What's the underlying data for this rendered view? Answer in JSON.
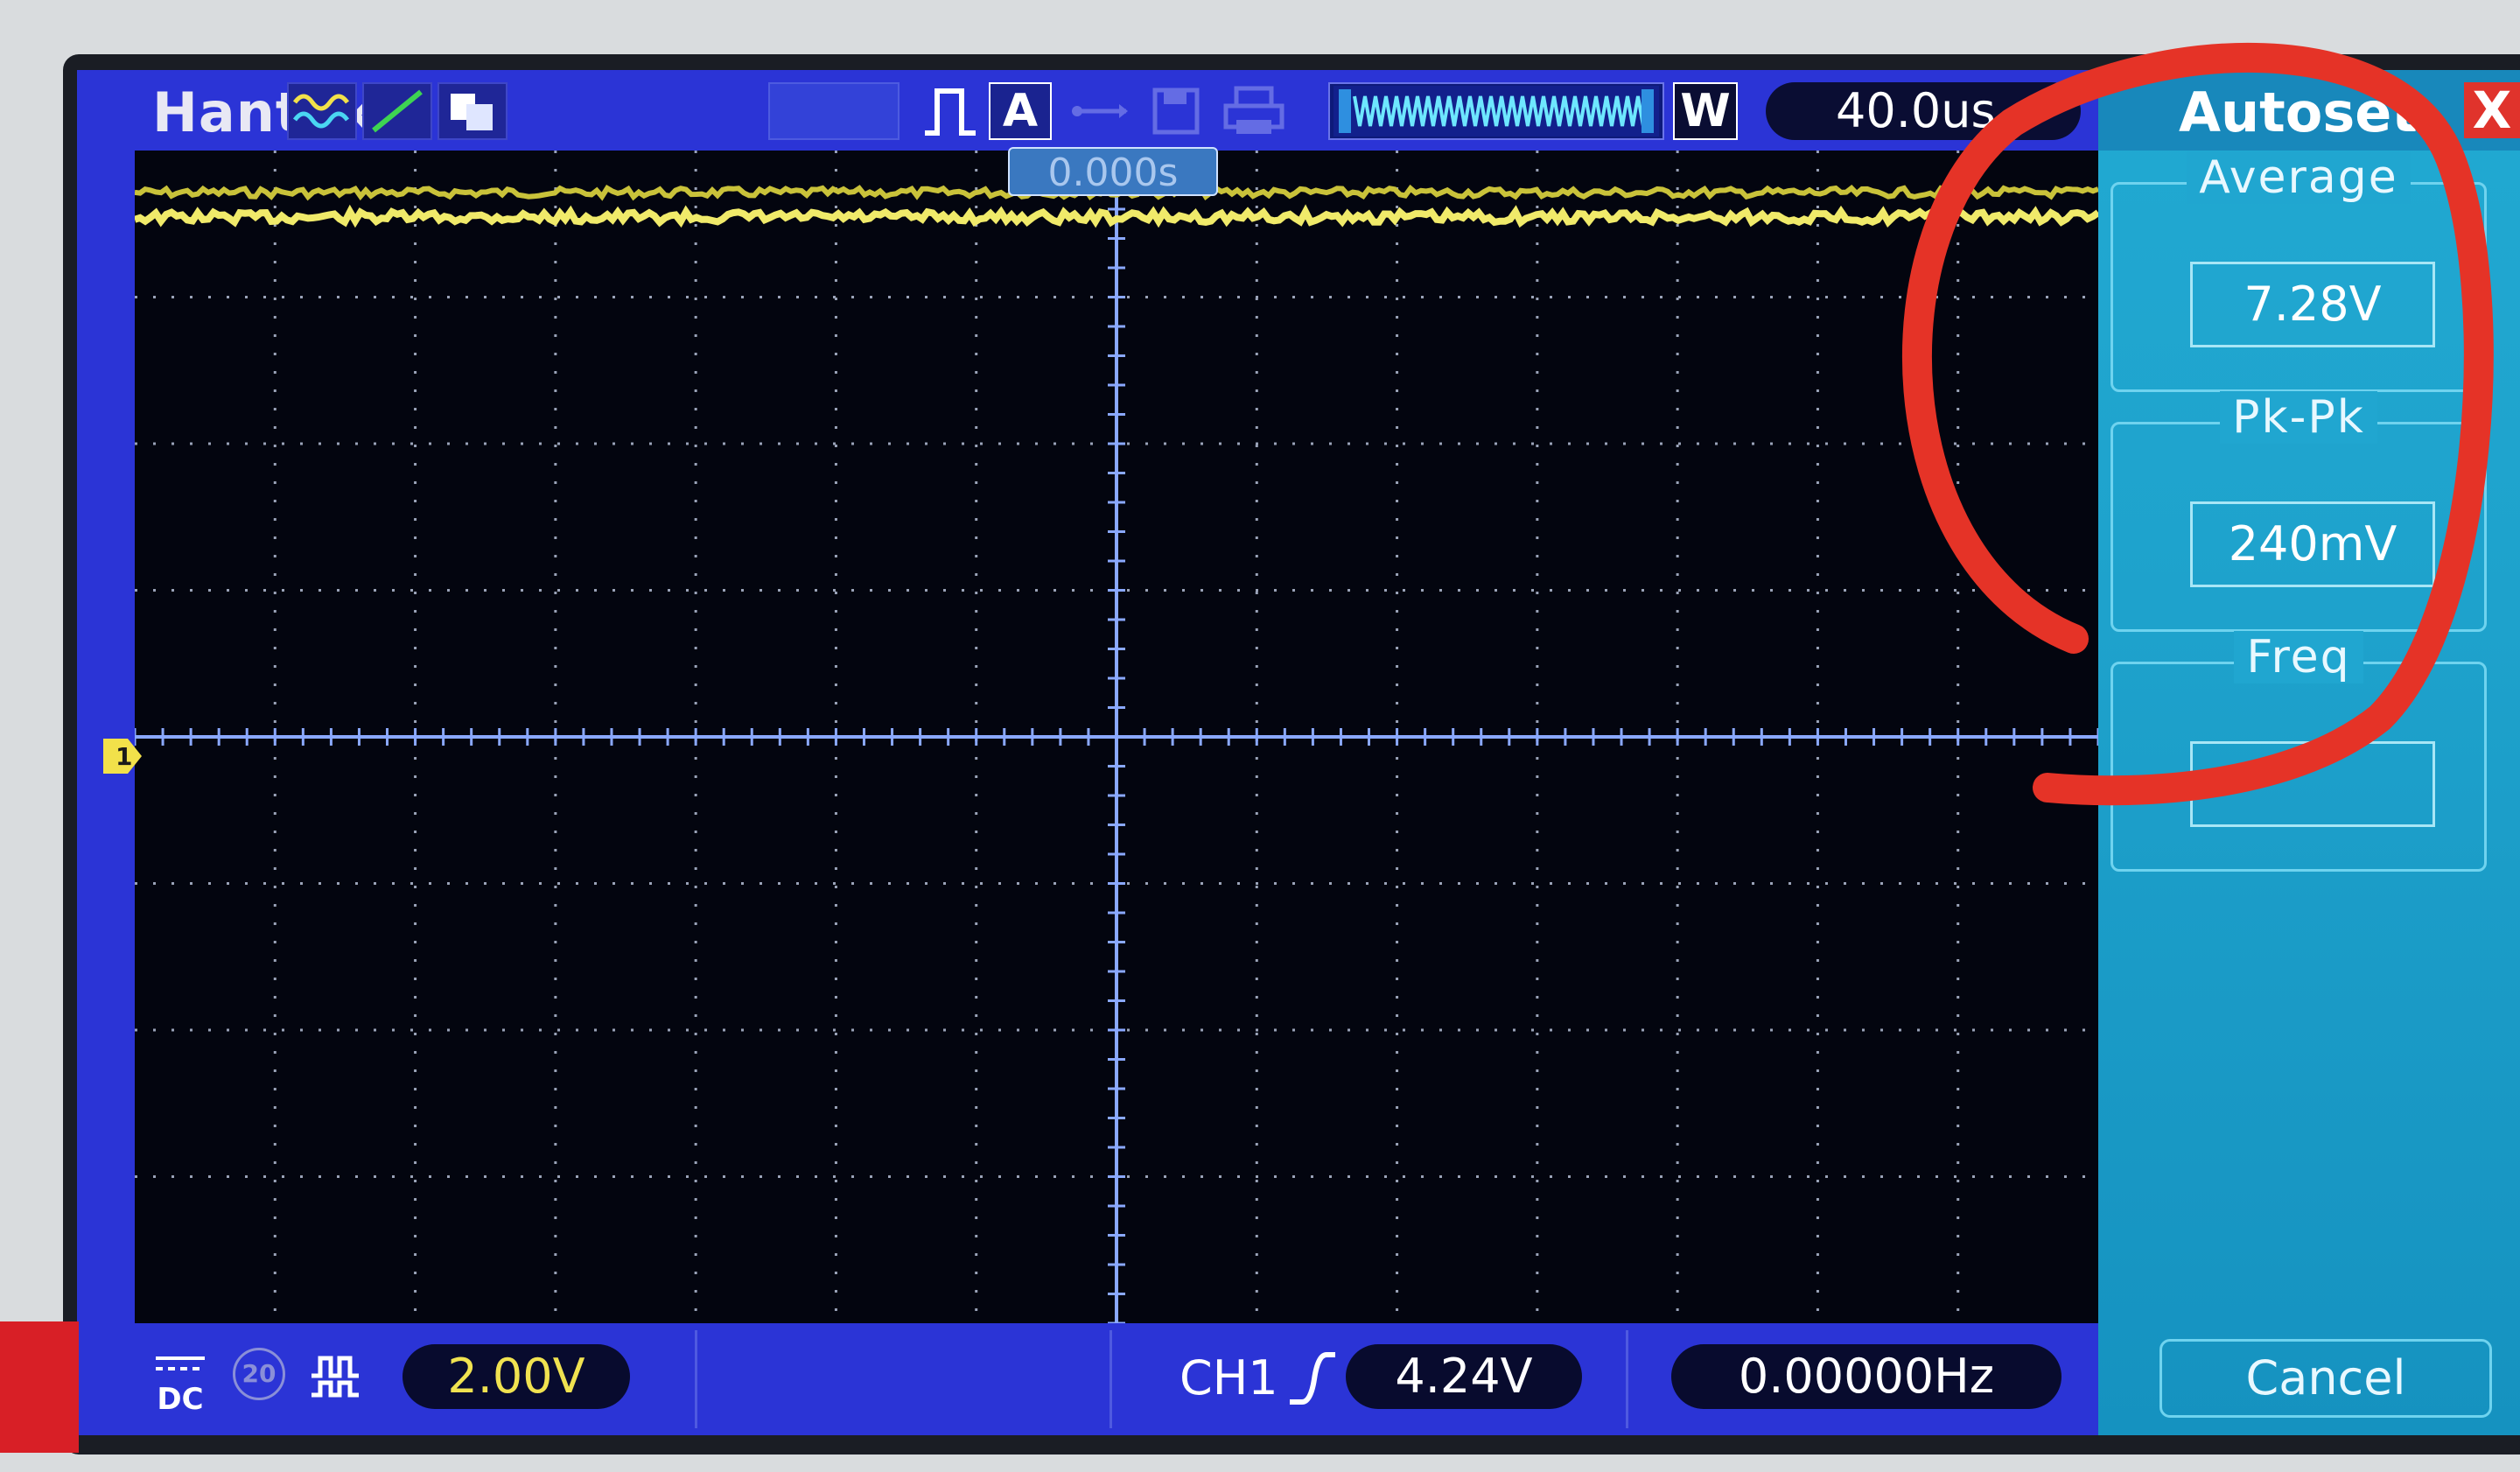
{
  "topbar": {
    "brand": "Hantek",
    "icons": [
      "waveform-display-icon",
      "line-mode-icon",
      "persist-icon",
      "trigger-pulse-icon",
      "auto-mode-icon",
      "usb-icon",
      "save-icon",
      "print-icon",
      "memory-depth-icon",
      "window-icon"
    ],
    "auto_label": "A",
    "window_label": "W",
    "timebase": "40.0us"
  },
  "graticule": {
    "trigger_position": "0.000s",
    "channel_marker": "1"
  },
  "panel": {
    "title": "Autoset",
    "close_label": "X",
    "measurements": [
      {
        "label": "Average",
        "value": "7.28V"
      },
      {
        "label": "Pk-Pk",
        "value": "240mV"
      },
      {
        "label": "Freq",
        "value": ""
      }
    ],
    "cancel_label": "Cancel"
  },
  "bottombar": {
    "coupling": "DC",
    "bandwidth_limit": "20",
    "volts_per_div": "2.00V",
    "trigger_source": "CH1",
    "trigger_level": "4.24V",
    "frequency": "0.00000Hz"
  },
  "colors": {
    "screen_blue": "#2b34d6",
    "trace_yellow": "#e6e24a",
    "panel_cyan": "#1ea2cc",
    "annotation_red": "#e53327"
  }
}
